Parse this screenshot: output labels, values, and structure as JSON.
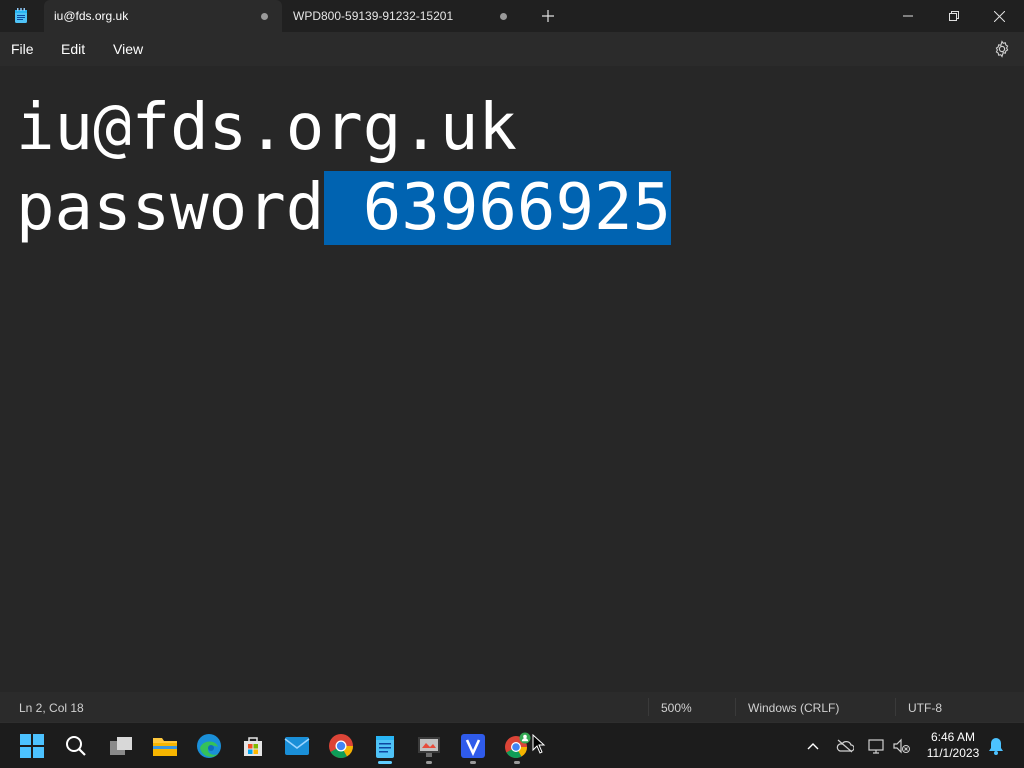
{
  "tabs": [
    {
      "title": "iu@fds.org.uk"
    },
    {
      "title": "WPD800-59139-91232-15201"
    }
  ],
  "menu": {
    "file": "File",
    "edit": "Edit",
    "view": "View"
  },
  "editor": {
    "line1": "iu@fds.org.uk",
    "line2_prefix": "password",
    "line2_selected": " 63966925"
  },
  "status": {
    "position": "Ln 2, Col 18",
    "zoom": "500%",
    "line_ending": "Windows (CRLF)",
    "encoding": "UTF-8"
  },
  "clock": {
    "time": "6:46 AM",
    "date": "11/1/2023"
  },
  "taskbar": {
    "icons": [
      "windows-start-icon",
      "search-icon",
      "task-view-icon",
      "file-explorer-icon",
      "edge-icon",
      "microsoft-store-icon",
      "mail-icon",
      "chrome-icon",
      "notepad-icon",
      "paint-icon",
      "v-app-icon",
      "chrome-profile-icon"
    ]
  },
  "colors": {
    "selection": "#0063b1",
    "accent": "#60cdff",
    "background": "#272727"
  }
}
